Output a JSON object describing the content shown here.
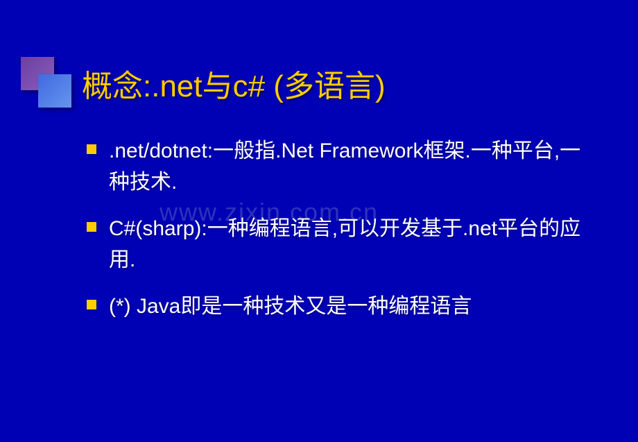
{
  "slide": {
    "title": "概念:.net与c#   (多语言)",
    "bullets": [
      ".net/dotnet:一般指.Net Framework框架.一种平台,一种技术.",
      "C#(sharp):一种编程语言,可以开发基于.net平台的应用.",
      "(*) Java即是一种技术又是一种编程语言"
    ],
    "watermark": "www.zixin.com.cn"
  }
}
